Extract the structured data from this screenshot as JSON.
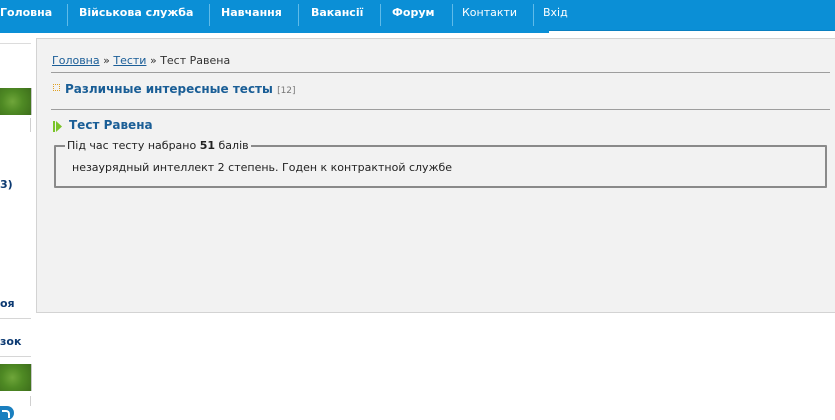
{
  "nav": {
    "items": [
      {
        "label": "Головна"
      },
      {
        "label": "Військова служба"
      },
      {
        "label": "Навчання"
      },
      {
        "label": "Вакансії"
      },
      {
        "label": "Форум"
      },
      {
        "label": "Контакти"
      },
      {
        "label": "Вхід"
      }
    ]
  },
  "sidebar": {
    "fragments": [
      "3)",
      "оя",
      "зок"
    ]
  },
  "breadcrumb": {
    "home": "Головна",
    "sep1": " » ",
    "tests": "Тести",
    "sep2": " » ",
    "current": "Тест Равена"
  },
  "category": {
    "title": "Различные интересные тесты",
    "count": "[12]"
  },
  "test": {
    "title": "Тест Равена",
    "score_prefix": "Під час тесту набрано ",
    "score": "51",
    "score_suffix": " балів",
    "result": "незаурядный интеллект 2 степень. Годен к контрактной службе"
  },
  "colors": {
    "nav_bg": "#0b8fd6",
    "link": "#1b5e98",
    "heading": "#1a5e96",
    "panel_bg": "#f2f2f2",
    "arrow": "#7bc42a"
  },
  "icons": {
    "category_bullet": "dotted-square-icon",
    "test_arrow": "play-arrow-icon"
  }
}
